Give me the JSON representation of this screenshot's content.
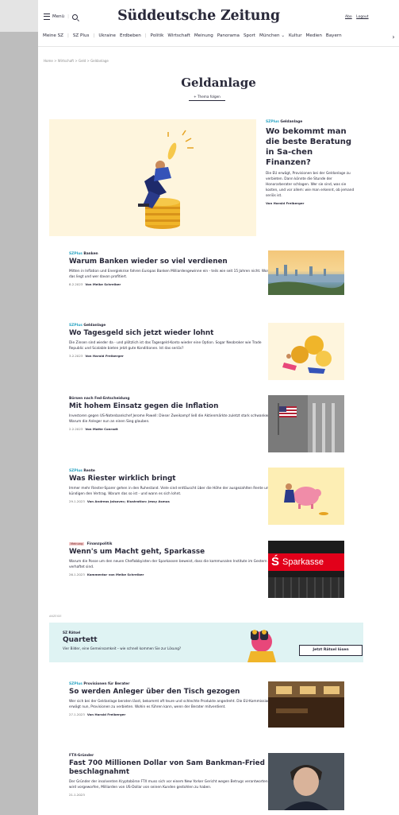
{
  "header": {
    "menu_label": "Menü",
    "logo": "Süddeutsche Zeitung",
    "abo": "Abo",
    "logout": "Logout"
  },
  "nav": {
    "items": [
      "Meine SZ",
      "SZ Plus",
      "Ukraine",
      "Erdbeben",
      "Politik",
      "Wirtschaft",
      "Meinung",
      "Panorama",
      "Sport",
      "München",
      "Kultur",
      "Medien",
      "Bayern"
    ],
    "more_icon": "chevron-right-icon"
  },
  "breadcrumb": "Home  >  Wirtschaft  >  Geld  >  Geldanlage",
  "page": {
    "title": "Geldanlage",
    "follow": "+ Thema folgen"
  },
  "hero": {
    "plus": "SZPlus",
    "kicker": "Geldanlage",
    "title": "Wo bekommt man die beste Beratung in Sa-chen Finanzen?",
    "tease": "Die EU erwägt, Provisionen bei der Geldanlage zu verbieten. Dann könnte die Stunde der Honorarberater schlagen. Wer sie sind, was sie kosten, und vor allem: wie man erkennt, ob jemand seriös ist.",
    "byline": "Von Harald Freiberger"
  },
  "articles": [
    {
      "plus": "SZPlus",
      "badge": "",
      "kicker": "Banken",
      "title": "Warum Banken wieder so viel verdienen",
      "tease": "Mitten in Inflation und Energiekrise fahren Europas Banken Milliardengewinne ein - teils wie seit 15 Jahren nicht. Woran das liegt und wer davon profitiert.",
      "date": "8.2.2023",
      "author": "Von Meike Schreiber"
    },
    {
      "plus": "SZPlus",
      "badge": "",
      "kicker": "Geldanlage",
      "title": "Wo Tagesgeld sich jetzt wieder lohnt",
      "tease": "Die Zinsen sind wieder da - und plötzlich ist das Tagesgeld-Konto wieder eine Option. Sogar Neobroker wie Trade Republic und Scalable bieten jetzt gute Konditionen. Ist das seriös?",
      "date": "3.2.2023",
      "author": "Von Harald Freiberger"
    },
    {
      "plus": "",
      "badge": "",
      "kicker": "Börsen nach Fed-Entscheidung",
      "title": "Mit hohem Einsatz gegen die Inflation",
      "tease": "Investoren gegen US-Notenbankchef Jerome Powell: Dieser Zweikampf ließ die Aktienmärkte zuletzt stark schwanken. Warum die Anleger nun an einen Sieg glauben.",
      "date": "2.2.2023",
      "author": "Von Matte Conradt"
    },
    {
      "plus": "SZPlus",
      "badge": "",
      "kicker": "Rente",
      "title": "Was Riester wirklich bringt",
      "tease": "Immer mehr Riester-Sparer gehen in den Ruhestand. Viele sind enttäuscht über die Höhe der ausgezahlten Rente und kündigen den Vertrag. Warum das so ist - und wann es sich lohnt.",
      "date": "29.1.2023",
      "author": "Von Andreas Jalsovec; Illustration: Jessy Asmus"
    },
    {
      "plus": "",
      "badge": "Meinung",
      "kicker": "Finanzpolitik",
      "title": "Wenn's um Macht geht, Sparkasse",
      "tease": "Warum die Posse um den neuen Cheflobbyisten der Sparkassen beweist, dass die kommunalen Institute im Gestern verhaftet sind.",
      "date": "26.1.2023",
      "author": "Kommentar von Meike Schreiber"
    },
    {
      "plus": "SZPlus",
      "badge": "",
      "kicker": "Provisionen für Berater",
      "title": "So werden Anleger über den Tisch gezogen",
      "tease": "Wer sich bei der Geldanlage beraten lässt, bekommt oft teure und schlechte Produkte angedreht. Die EU-Kommission erwägt nun, Provisionen zu verbieten. Wohin es führen kann, wenn der Berater mitverdient.",
      "date": "27.1.2023",
      "author": "Von Harald Freiberger"
    },
    {
      "plus": "",
      "badge": "",
      "kicker": "FTX-Gründer",
      "title": "Fast 700 Millionen Dollar von Sam Bankman-Fried beschlagnahmt",
      "tease": "Der Gründer der insolventen Kryptobörse FTX muss sich vor einem New Yorker Gericht wegen Betrugs verantworten. Ihm wird vorgeworfen, Milliarden von US-Dollar von seinen Kunden gestohlen zu haben.",
      "date": "21.1.2023",
      "author": ""
    }
  ],
  "ad": {
    "label": "ANZEIGE",
    "kicker": "SZ Rätsel",
    "title": "Quartett",
    "sub": "Vier Bilder, eine Gemeinsamkeit – wie schnell kommen Sie zur Lösung?",
    "button": "Jetzt Rätsel lösen"
  },
  "images": {
    "sparkasse_sign": "Sparkasse"
  },
  "colors": {
    "text": "#29293a",
    "plus_blue": "#29a3c2",
    "hero_bg": "#fef5dd",
    "ad_bg": "#dff3f3",
    "sparkasse_red": "#e2001a"
  }
}
